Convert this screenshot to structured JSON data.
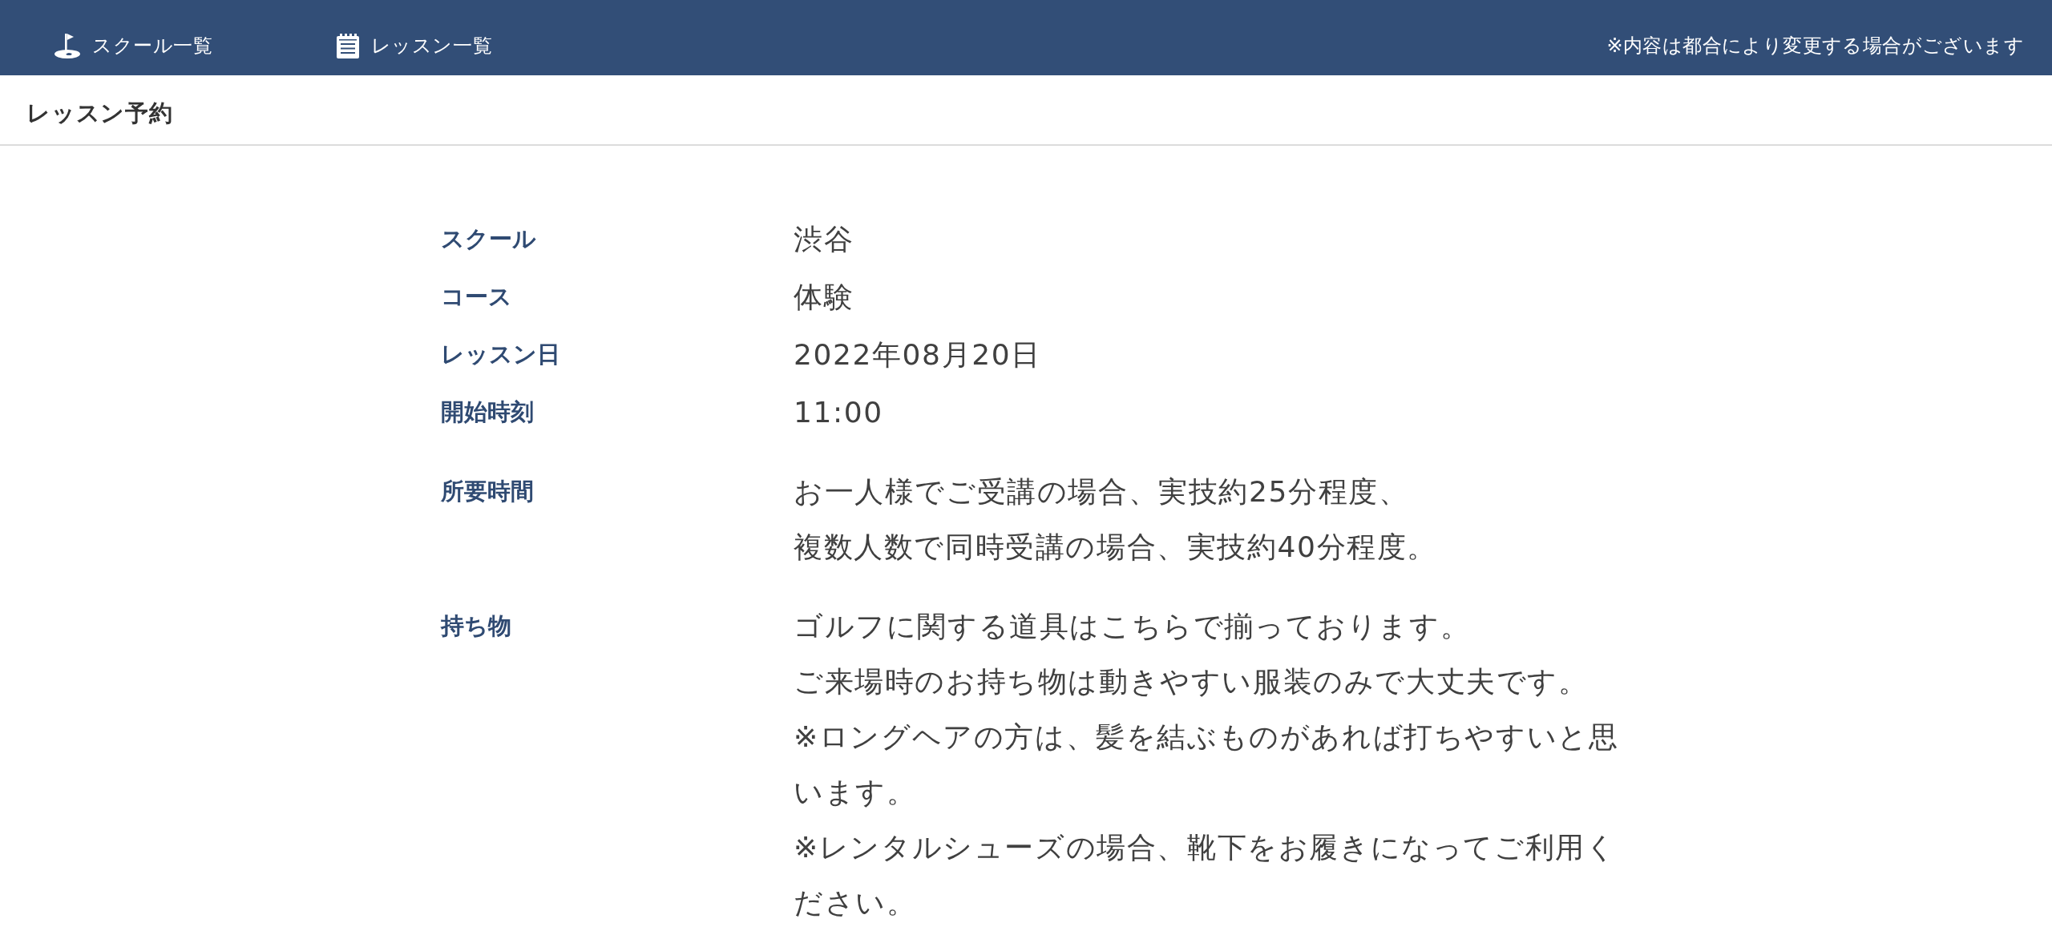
{
  "header": {
    "nav": [
      {
        "kind": "school",
        "label": "スクール一覧"
      },
      {
        "kind": "lesson",
        "label": "レッスン一覧"
      }
    ],
    "notice": "※内容は都合により変更する場合がございます"
  },
  "page_title": "レッスン予約",
  "details": [
    {
      "label": "スクール",
      "lines": [
        "渋谷"
      ]
    },
    {
      "label": "コース",
      "lines": [
        "体験"
      ]
    },
    {
      "label": "レッスン日",
      "lines": [
        "2022年08月20日"
      ]
    },
    {
      "label": "開始時刻",
      "lines": [
        "11:00"
      ]
    },
    {
      "label": "所要時間",
      "lines": [
        "お一人様でご受講の場合、実技約25分程度、",
        "複数人数で同時受講の場合、実技約40分程度。"
      ]
    },
    {
      "label": "持ち物",
      "lines": [
        "ゴルフに関する道具はこちらで揃っております。",
        "ご来場時のお持ち物は動きやすい服装のみで大丈夫です。",
        "※ロングヘアの方は、髪を結ぶものがあれば打ちやすいと思います。",
        "※レンタルシューズの場合、靴下をお履きになってご利用ください。"
      ]
    }
  ]
}
